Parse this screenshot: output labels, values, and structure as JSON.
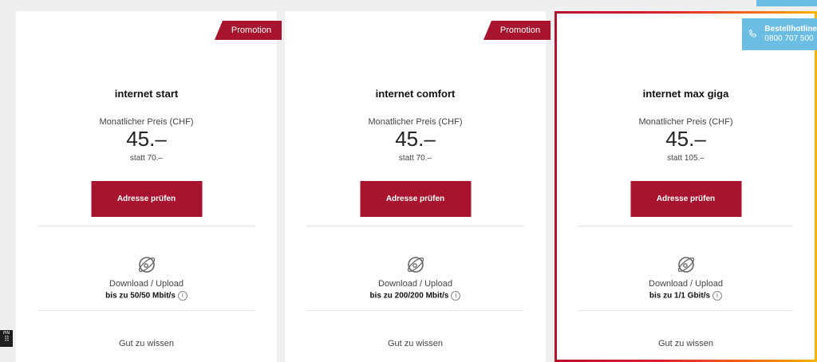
{
  "hotline": {
    "title": "Bestellhotline",
    "number": "0800 707 500"
  },
  "fab": {
    "label": "PIN",
    "icon": "keypad-icon"
  },
  "cards": [
    {
      "promo": "Promotion",
      "title": "internet start",
      "price_label": "Monatlicher Preis (CHF)",
      "price": "45.–",
      "was": "statt 70.–",
      "button": "Adresse prüfen",
      "dl_label": "Download / Upload",
      "dl_value": "bis zu 50/50 Mbit/s",
      "good": "Gut zu wissen"
    },
    {
      "promo": "Promotion",
      "title": "internet comfort",
      "price_label": "Monatlicher Preis (CHF)",
      "price": "45.–",
      "was": "statt 70.–",
      "button": "Adresse prüfen",
      "dl_label": "Download / Upload",
      "dl_value": "bis zu 200/200 Mbit/s",
      "good": "Gut zu wissen"
    },
    {
      "title": "internet max giga",
      "price_label": "Monatlicher Preis (CHF)",
      "price": "45.–",
      "was": "statt 105.–",
      "button": "Adresse prüfen",
      "dl_label": "Download / Upload",
      "dl_value": "bis zu 1/1 Gbit/s",
      "good": "Gut zu wissen"
    }
  ],
  "colors": {
    "brand_red": "#a8142e",
    "hotline_blue": "#6cbde3"
  }
}
